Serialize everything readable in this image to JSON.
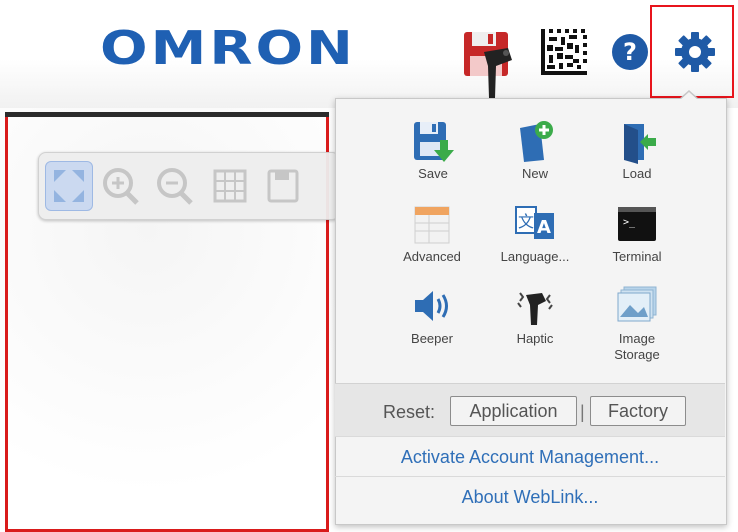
{
  "header": {
    "logo_text": "OMRON",
    "icons": [
      "save-config-icon",
      "barcode-icon",
      "help-icon",
      "settings-gear-icon"
    ]
  },
  "toolbar": {
    "buttons": [
      "fit-screen-icon",
      "zoom-in-icon",
      "zoom-out-icon",
      "grid-icon",
      "save-image-icon"
    ]
  },
  "menu": {
    "items": [
      {
        "label": "Save",
        "icon": "save-icon"
      },
      {
        "label": "New",
        "icon": "new-file-icon"
      },
      {
        "label": "Load",
        "icon": "load-icon"
      },
      {
        "label": "Advanced",
        "icon": "advanced-table-icon"
      },
      {
        "label": "Language...",
        "icon": "language-icon"
      },
      {
        "label": "Terminal",
        "icon": "terminal-icon"
      },
      {
        "label": "Beeper",
        "icon": "speaker-icon"
      },
      {
        "label": "Haptic",
        "icon": "haptic-icon"
      },
      {
        "label": "Image",
        "label2": "Storage",
        "icon": "image-storage-icon"
      }
    ],
    "reset_label": "Reset:",
    "reset_application": "Application",
    "reset_separator": "|",
    "reset_factory": "Factory",
    "activate_link": "Activate Account Management...",
    "about_link": "About WebLink..."
  },
  "colors": {
    "brand": "#1f60b3",
    "highlight_red": "#e8141c",
    "link_blue": "#2f6fb8"
  }
}
